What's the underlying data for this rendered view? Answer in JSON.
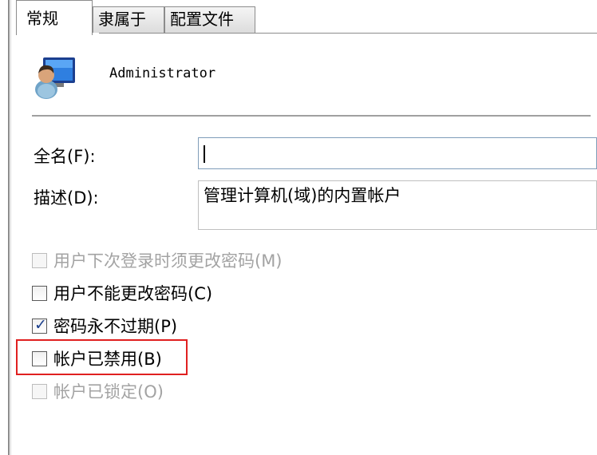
{
  "tabs": [
    {
      "label": "常规",
      "active": true
    },
    {
      "label": "隶属于",
      "active": false
    },
    {
      "label": "配置文件",
      "active": false
    }
  ],
  "user": {
    "name": "Administrator",
    "icon": "user-account-icon"
  },
  "fields": {
    "fullname_label": "全名(F):",
    "fullname_value": "",
    "description_label": "描述(D):",
    "description_value": "管理计算机(域)的内置帐户"
  },
  "options": [
    {
      "label": "用户下次登录时须更改密码(M)",
      "checked": false,
      "enabled": false
    },
    {
      "label": "用户不能更改密码(C)",
      "checked": false,
      "enabled": true
    },
    {
      "label": "密码永不过期(P)",
      "checked": true,
      "enabled": true
    },
    {
      "label": "帐户已禁用(B)",
      "checked": false,
      "enabled": true
    },
    {
      "label": "帐户已锁定(O)",
      "checked": false,
      "enabled": false
    }
  ],
  "colors": {
    "highlight": "#e02020",
    "check": "#1a3e8c"
  }
}
